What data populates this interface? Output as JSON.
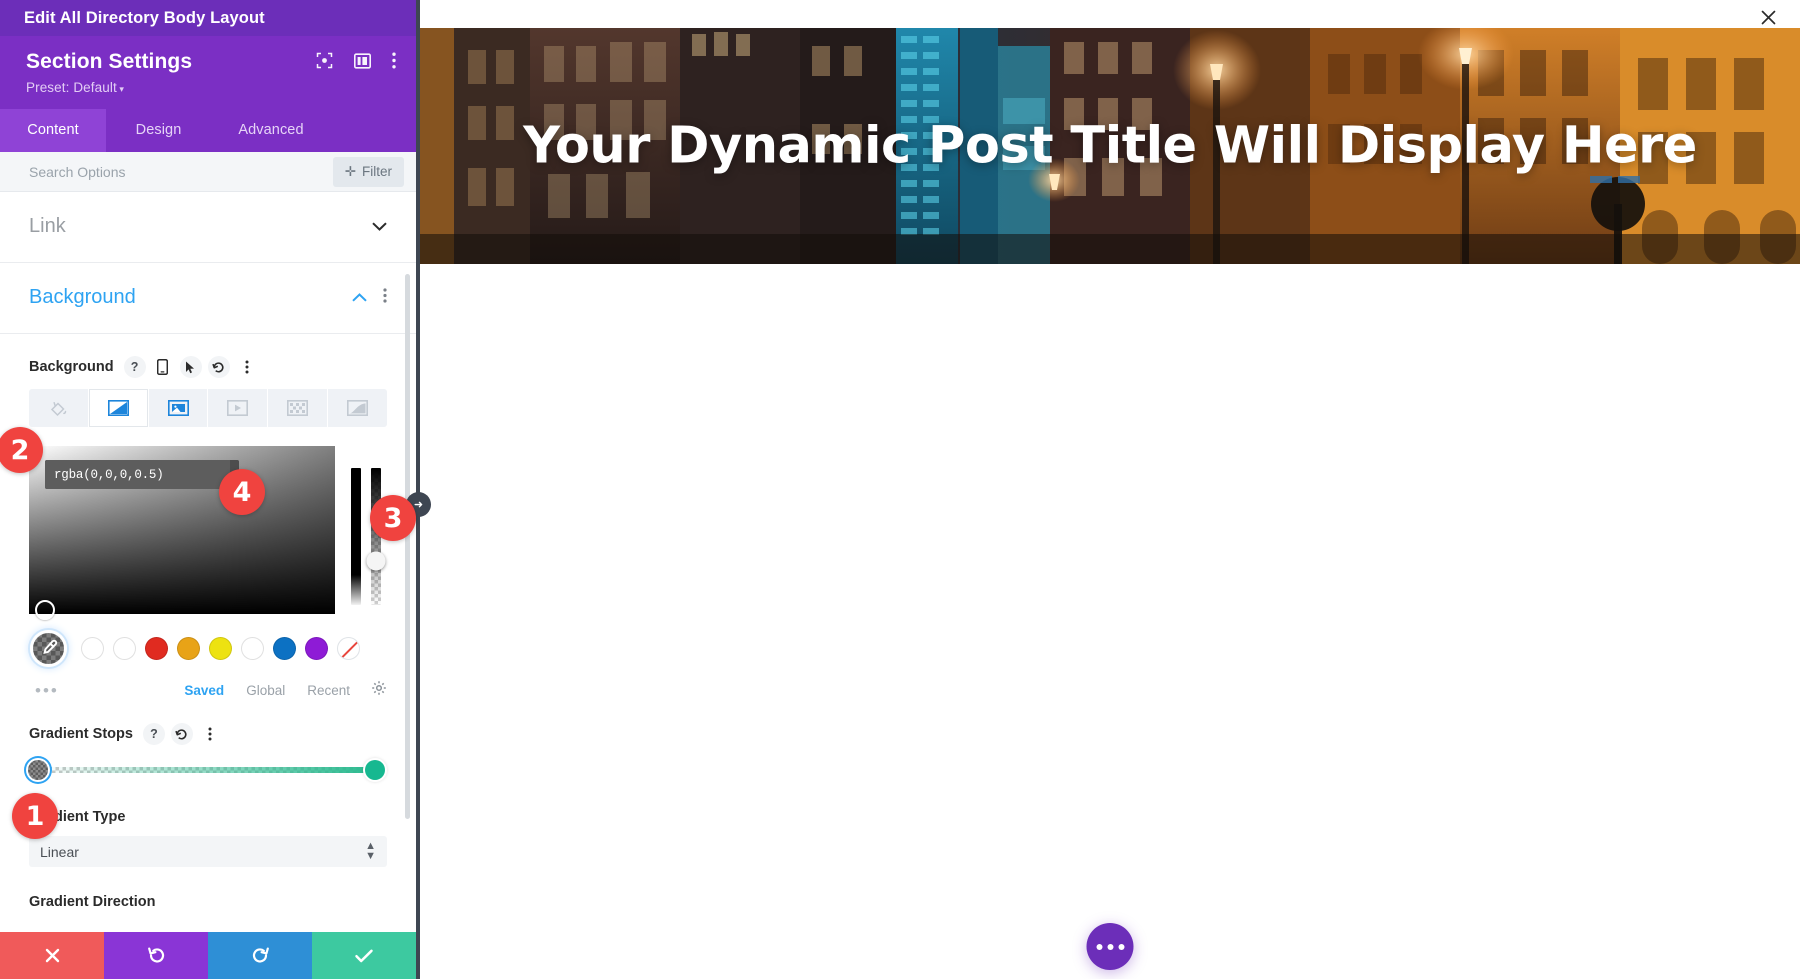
{
  "window": {
    "title": "Edit All Directory Body Layout",
    "close_icon": "close-icon"
  },
  "panel": {
    "title": "Section Settings",
    "preset_label": "Preset: Default",
    "header_icons": [
      "focus-frame-icon",
      "layout-columns-icon",
      "vertical-dots-icon"
    ],
    "tabs": [
      {
        "label": "Content",
        "active": true
      },
      {
        "label": "Design",
        "active": false
      },
      {
        "label": "Advanced",
        "active": false
      }
    ],
    "search": {
      "placeholder": "Search Options",
      "value": "",
      "filter_label": "Filter",
      "filter_icon": "plus-icon"
    },
    "accordions": [
      {
        "label": "Link",
        "open": false,
        "chevron": "chevron-down-icon"
      },
      {
        "label": "Background",
        "open": true,
        "chevron": "chevron-up-icon"
      }
    ],
    "background": {
      "option_label": "Background",
      "option_icons": [
        "help-icon",
        "mobile-icon",
        "cursor-icon",
        "reset-icon",
        "vertical-dots-icon"
      ],
      "type_tabs": [
        {
          "name": "solid-color",
          "icon": "paint-bucket-icon",
          "active": false
        },
        {
          "name": "gradient",
          "icon": "gradient-icon",
          "active": true
        },
        {
          "name": "image",
          "icon": "image-icon",
          "active": false
        },
        {
          "name": "video",
          "icon": "video-icon",
          "active": false
        },
        {
          "name": "pattern",
          "icon": "pattern-icon",
          "active": false
        },
        {
          "name": "mask",
          "icon": "mask-icon",
          "active": false
        }
      ],
      "color_value": "rgba(0,0,0,0.5)",
      "confirm_icon": "check-icon",
      "eyedropper_icon": "eyedropper-icon",
      "swatches": [
        {
          "name": "swatch-white-1",
          "color": "#ffffff"
        },
        {
          "name": "swatch-white-2",
          "color": "#ffffff"
        },
        {
          "name": "swatch-red",
          "color": "#E02B20"
        },
        {
          "name": "swatch-orange",
          "color": "#E8A317"
        },
        {
          "name": "swatch-yellow",
          "color": "#EDE211"
        },
        {
          "name": "swatch-white-3",
          "color": "#ffffff"
        },
        {
          "name": "swatch-blue",
          "color": "#0C71C3"
        },
        {
          "name": "swatch-purple",
          "color": "#8E1BD6"
        },
        {
          "name": "swatch-none",
          "color": "transparent"
        }
      ],
      "palette_tabs": [
        {
          "label": "Saved",
          "active": true
        },
        {
          "label": "Global",
          "active": false
        },
        {
          "label": "Recent",
          "active": false
        }
      ],
      "palette_settings_icon": "gear-icon",
      "more_dots": "•••"
    },
    "gradient_stops": {
      "label": "Gradient Stops",
      "icons": [
        "help-icon",
        "reset-icon",
        "vertical-dots-icon"
      ],
      "start_color": "transparent",
      "end_color": "#17B890"
    },
    "gradient_type": {
      "label": "Gradient Type",
      "value": "Linear"
    },
    "gradient_direction": {
      "label": "Gradient Direction"
    },
    "actions": [
      {
        "name": "cancel-button",
        "icon": "✕",
        "color": "#F05A5A"
      },
      {
        "name": "undo-button",
        "icon": "↺",
        "color": "#8A35D6"
      },
      {
        "name": "redo-button",
        "icon": "↻",
        "color": "#2E8FD6"
      },
      {
        "name": "save-button",
        "icon": "✔",
        "color": "#3DC9A0"
      }
    ],
    "collapse_handle_icon": "arrow-right-icon"
  },
  "preview": {
    "hero_title": "Your Dynamic Post Title Will Display Here",
    "fab_icon": "ellipsis-icon"
  },
  "annotations": [
    {
      "number": "1",
      "target": "gradient-stops-slider"
    },
    {
      "number": "2",
      "target": "color-value-input"
    },
    {
      "number": "3",
      "target": "panel-collapse-handle"
    },
    {
      "number": "4",
      "target": "color-confirm-button"
    }
  ],
  "colors": {
    "brand_purple": "#7B2FC4",
    "topbar_purple": "#6C2EB9",
    "accent_blue": "#2EA3F2",
    "badge_red": "#F0433F",
    "teal": "#17B890"
  }
}
